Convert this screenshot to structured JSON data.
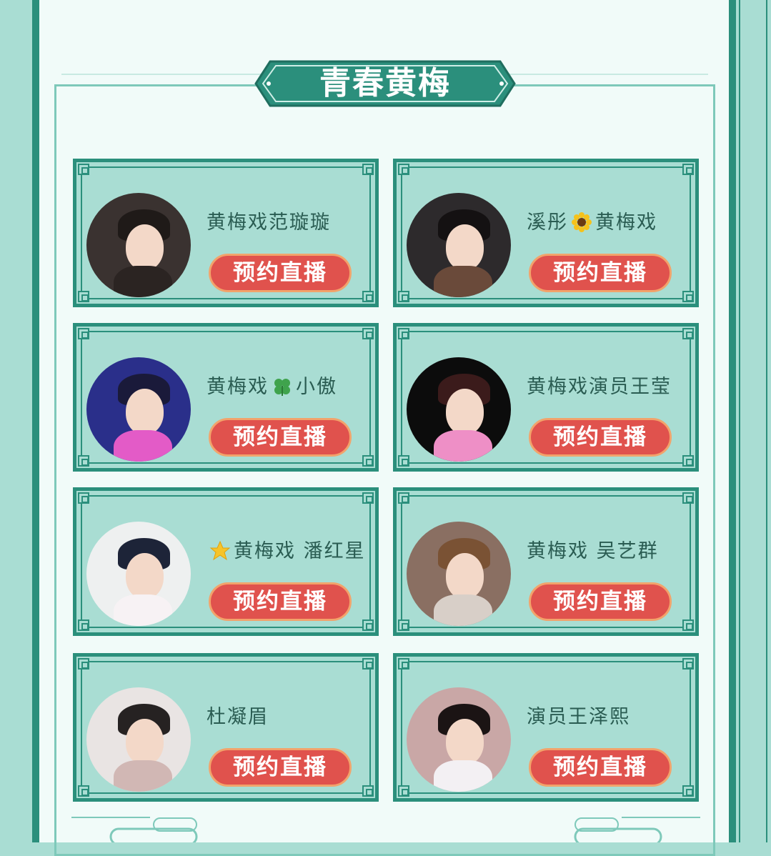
{
  "section": {
    "title": "青春黄梅"
  },
  "performers": [
    {
      "name": "黄梅戏范璇璇",
      "button_label": "预约直播",
      "avatar_bg": "#3a3230",
      "hair": "#1f1a18",
      "body": "#2b2422"
    },
    {
      "name_before": "溪彤",
      "emoji": "sunflower-icon",
      "name_after": "黄梅戏",
      "button_label": "预约直播",
      "avatar_bg": "#2d2a2c",
      "hair": "#141112",
      "body": "#6a4a3a"
    },
    {
      "name_before": "黄梅戏",
      "emoji": "four-leaf-clover-icon",
      "name_after": "小傲",
      "button_label": "预约直播",
      "avatar_bg": "#2a2f8a",
      "hair": "#1a1a3a",
      "body": "#e35bc7"
    },
    {
      "name": "黄梅戏演员王莹",
      "button_label": "预约直播",
      "avatar_bg": "#0c0c0c",
      "hair": "#3b1b1b",
      "body": "#ee8fc6"
    },
    {
      "emoji": "star-icon",
      "name_after": "黄梅戏 潘红星",
      "button_label": "预约直播",
      "avatar_bg": "#eef0f0",
      "hair": "#1d2438",
      "body": "#f7f2f4"
    },
    {
      "name": "黄梅戏 吴艺群",
      "button_label": "预约直播",
      "avatar_bg": "#8a6f62",
      "hair": "#7a5234",
      "body": "#d8cfc8"
    },
    {
      "name": "杜凝眉",
      "button_label": "预约直播",
      "avatar_bg": "#e9e4e3",
      "hair": "#262222",
      "body": "#d1b7b4"
    },
    {
      "name": "演员王泽熙",
      "button_label": "预约直播",
      "avatar_bg": "#c9a7a6",
      "hair": "#1b1414",
      "body": "#f3f0f3"
    }
  ],
  "colors": {
    "teal_dark": "#2b8f7c",
    "teal_light": "#a9ddd3",
    "button_red": "#e0524d",
    "button_border": "#f2a36b"
  }
}
